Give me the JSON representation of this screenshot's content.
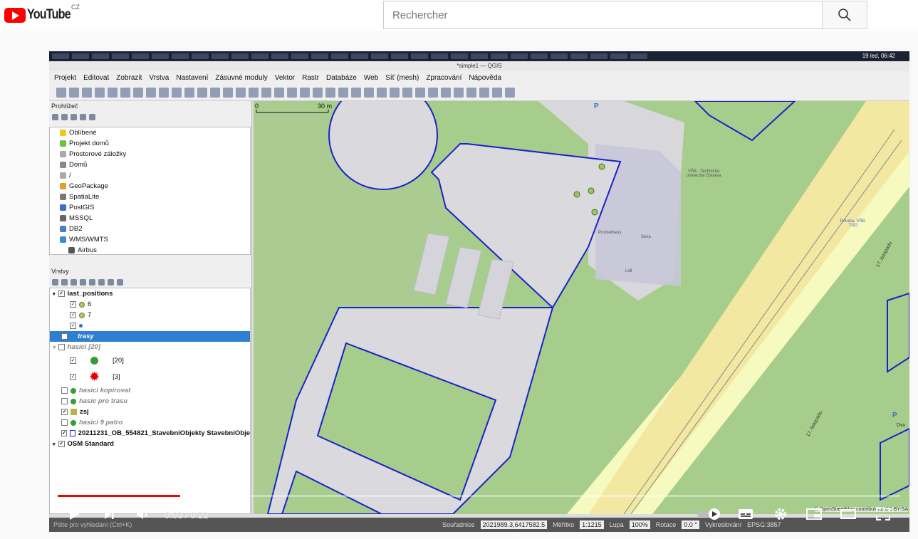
{
  "youtube": {
    "logo_text": "YouTube",
    "country_code": "CZ",
    "search_placeholder": "Rechercher"
  },
  "video": {
    "current_time": "0:03",
    "duration": "0:22",
    "time_separator": "/",
    "progress_fraction": 0.145
  },
  "qgis": {
    "window_title": "*simple1 — QGIS",
    "clock": "19 led, 06:42",
    "menu": [
      "Projekt",
      "Editovat",
      "Zobrazit",
      "Vrstva",
      "Nastavení",
      "Zásuvné moduly",
      "Vektor",
      "Rastr",
      "Databáze",
      "Web",
      "Síť (mesh)",
      "Zpracování",
      "Nápověda"
    ],
    "browser_title": "Prohlížeč",
    "browser_items": [
      "Oblíbené",
      "Projekt domů",
      "Prostorové záložky",
      "Domů",
      "/",
      "GeoPackage",
      "SpatiaLite",
      "PostGIS",
      "MSSQL",
      "DB2",
      "WMS/WMTS",
      "Airbus"
    ],
    "layers_title": "Vrstvy",
    "layers": {
      "last_positions": "last_positions",
      "lp_class_6": "6",
      "lp_class_7": "7",
      "trasy": "trasy",
      "hasici": "hasici [20]",
      "hasici_class_20": "[20]",
      "hasici_class_3": "[3]",
      "hasici_kopirovat": "hasici kopírovat",
      "hasic_pro_trasu": "hasic pro trasu",
      "zsj": "zsj",
      "hasici_9_patro": "hasici 9 patro",
      "stavebni": "20211231_OB_554821_StavebniObjekty StavebniObje",
      "osm": "OSM Standard"
    },
    "locator_placeholder": "Pište pro vyhledání (Ctrl+K)",
    "status": {
      "coord_label": "Souřadnice",
      "coord_value": "2021989.3,6417582.5",
      "scale_label": "Měřítko",
      "scale_value": "1:1215",
      "magnifier_label": "Lupa",
      "magnifier_value": "100%",
      "rotation_label": "Rotace",
      "rotation_value": "0.0 °",
      "render_label": "Vykreslování",
      "crs": "EPSG:3857"
    },
    "map": {
      "scalebar_start": "0",
      "scalebar_label": "30 m",
      "poi_vsb": "VŠB - Technická univerzita Ostrava",
      "poi_prometheus": "Prometheus",
      "poi_sova": "Sova",
      "poi_lidl": "Lidl",
      "poi_poruba": "Poruba, VŠB-TUO",
      "street": "17. listopadu",
      "street2": "Dvo",
      "attribution": "© OpenStreetMap contributors, CC BY-SA"
    }
  },
  "colors": {
    "youtube_red": "#ff0000",
    "selection_blue": "#2d7fd2",
    "building_outline": "#1a22c8",
    "grass": "#a6cd8c"
  }
}
